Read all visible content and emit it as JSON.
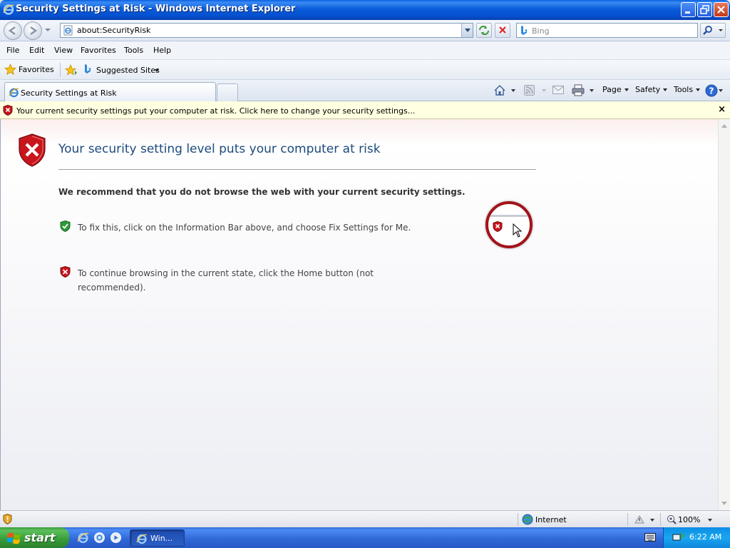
{
  "window": {
    "title": "Security Settings at Risk - Windows Internet Explorer"
  },
  "address_bar": {
    "url": "about:SecurityRisk",
    "search_placeholder": "Bing"
  },
  "menu": [
    "File",
    "Edit",
    "View",
    "Favorites",
    "Tools",
    "Help"
  ],
  "favorites_bar": {
    "favorites_label": "Favorites",
    "suggested_sites_label": "Suggested Sites"
  },
  "tab": {
    "title": "Security Settings at Risk"
  },
  "command_bar": {
    "page": "Page",
    "safety": "Safety",
    "tools": "Tools"
  },
  "info_bar": {
    "message": "Your current security settings put your computer at risk. Click here to change your security settings...",
    "close": "×"
  },
  "content": {
    "heading": "Your security setting level puts your computer at risk",
    "recommend": "We recommend that you do not browse the web with your current security settings.",
    "fix_text": "To fix this, click on the Information Bar above, and choose Fix Settings for Me.",
    "continue_text": "To continue browsing in the current state, click the Home button (not recommended)."
  },
  "status_bar": {
    "zone": "Internet",
    "zoom": "100%"
  },
  "taskbar": {
    "start_label": "start",
    "task_label": "Win...",
    "clock": "6:22 AM"
  },
  "colors": {
    "title_blue": "#0a5cd8",
    "heading_blue": "#1c4a7d",
    "info_bar_yellow": "#ffffe1",
    "shield_red": "#c8161d",
    "shield_green": "#2f9a3a",
    "start_green": "#379a37"
  }
}
